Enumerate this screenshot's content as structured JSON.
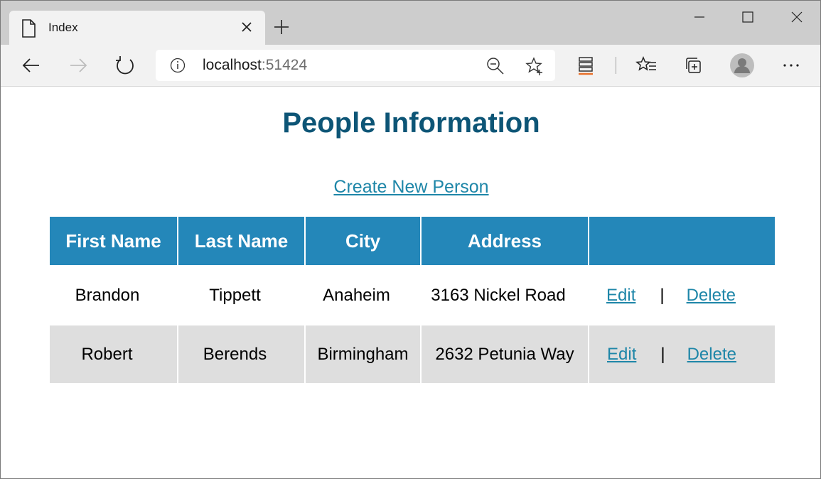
{
  "browser": {
    "tab": {
      "title": "Index",
      "icon": "page-icon"
    },
    "address": {
      "host": "localhost",
      "port": ":51424"
    }
  },
  "page": {
    "heading": "People Information",
    "create_link": "Create New Person",
    "table": {
      "headers": [
        "First Name",
        "Last Name",
        "City",
        "Address",
        ""
      ],
      "rows": [
        {
          "first": "Brandon",
          "last": "Tippett",
          "city": "Anaheim",
          "address": "3163 Nickel Road",
          "edit": "Edit",
          "sep": "|",
          "delete": "Delete"
        },
        {
          "first": "Robert",
          "last": "Berends",
          "city": "Birmingham",
          "address": "2632 Petunia Way",
          "edit": "Edit",
          "sep": "|",
          "delete": "Delete"
        }
      ]
    }
  },
  "colors": {
    "header_bg": "#2487b9",
    "heading": "#0d5576",
    "link": "#1e86a8",
    "row_alt": "#dedede"
  }
}
